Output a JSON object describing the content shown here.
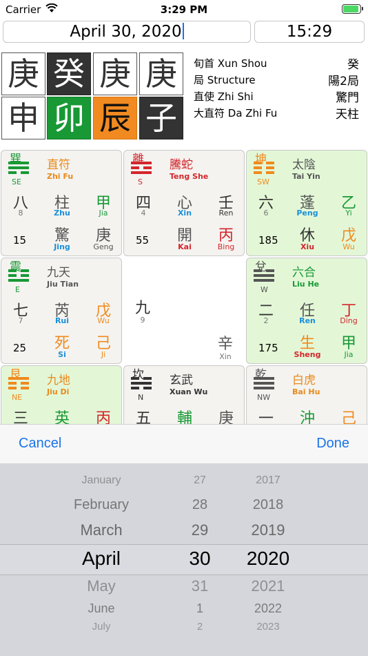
{
  "status": {
    "carrier": "Carrier",
    "time": "3:29 PM"
  },
  "date_field": {
    "value": "April 30, 2020"
  },
  "time_field": {
    "value": "15:29"
  },
  "ganzhi": {
    "row1": [
      "庚",
      "癸",
      "庚",
      "庚"
    ],
    "row2": [
      "申",
      "卯",
      "辰",
      "子"
    ]
  },
  "info": [
    {
      "label": "旬首 Xun Shou",
      "value": "癸"
    },
    {
      "label": "局 Structure",
      "value": "陽2局"
    },
    {
      "label": "直使 Zhi Shi",
      "value": "驚門"
    },
    {
      "label": "大直符 Da Zhi Fu",
      "value": "天柱"
    }
  ],
  "palaces": [
    {
      "gua": "巽",
      "dir": "SE",
      "god": "直符",
      "god_py": "Zhi Fu",
      "god_color": "#e88a1d",
      "tri_color": "#189935",
      "num_cn": "八",
      "num": "8",
      "star": "柱",
      "star_py": "Zhu",
      "stem1": "甲",
      "stem1_py": "Jia",
      "stem1_color": "#189935",
      "count": "15",
      "door": "驚",
      "door_py": "Jing",
      "stem2": "庚",
      "stem2_py": "Geng",
      "stem2_color": "#555555"
    },
    {
      "gua": "離",
      "dir": "S",
      "god": "騰蛇",
      "god_py": "Teng She",
      "god_color": "#d4262c",
      "tri_color": "#d4262c",
      "num_cn": "四",
      "num": "4",
      "star": "心",
      "star_py": "Xin",
      "stem1": "壬",
      "stem1_py": "Ren",
      "stem1_color": "#333333",
      "count": "55",
      "door": "開",
      "door_py": "Kai",
      "stem2": "丙",
      "stem2_py": "Bing",
      "stem2_color": "#d4262c"
    },
    {
      "gua": "坤",
      "dir": "SW",
      "god": "太陰",
      "god_py": "Tai Yin",
      "god_color": "#555555",
      "tri_color": "#f08a1d",
      "num_cn": "六",
      "num": "6",
      "star": "蓬",
      "star_py": "Peng",
      "stem1": "乙",
      "stem1_py": "Yi",
      "stem1_color": "#189935",
      "count": "185",
      "door": "休",
      "door_py": "Xiu",
      "stem2": "戊",
      "stem2_py": "Wu",
      "stem2_color": "#f08a1d"
    },
    {
      "gua": "震",
      "dir": "E",
      "god": "九天",
      "god_py": "Jiu Tian",
      "god_color": "#555555",
      "tri_color": "#189935",
      "num_cn": "七",
      "num": "7",
      "star": "芮",
      "star_py": "Rui",
      "stem1": "戊",
      "stem1_py": "Wu",
      "stem1_color": "#f08a1d",
      "count": "25",
      "door": "死",
      "door_py": "Si",
      "stem2": "己",
      "stem2_py": "Ji",
      "stem2_color": "#f08a1d"
    },
    {
      "center_num_cn": "九",
      "center_num": "9",
      "center_stem": "辛",
      "center_stem_py": "Xin"
    },
    {
      "gua": "兌",
      "dir": "W",
      "god": "六合",
      "god_py": "Liu He",
      "god_color": "#189935",
      "tri_color": "#555555",
      "num_cn": "二",
      "num": "2",
      "star": "任",
      "star_py": "Ren",
      "stem1": "丁",
      "stem1_py": "Ding",
      "stem1_color": "#d4262c",
      "count": "175",
      "door": "生",
      "door_py": "Sheng",
      "stem2": "甲",
      "stem2_py": "Jia",
      "stem2_color": "#189935"
    },
    {
      "gua": "艮",
      "dir": "NE",
      "god": "九地",
      "god_py": "Jiu Di",
      "god_color": "#e88a1d",
      "tri_color": "#f08a1d",
      "num_cn": "三",
      "star": "英",
      "stem1": "丙",
      "stem1_color": "#d4262c"
    },
    {
      "gua": "坎",
      "dir": "N",
      "god": "玄武",
      "god_py": "Xuan Wu",
      "god_color": "#333333",
      "tri_color": "#333333",
      "num_cn": "五",
      "star": "輔",
      "stem1": "庚",
      "stem1_color": "#555555"
    },
    {
      "gua": "乾",
      "dir": "NW",
      "god": "白虎",
      "god_py": "Bai Hu",
      "god_color": "#e88a1d",
      "tri_color": "#555555",
      "num_cn": "一",
      "star": "沖",
      "stem1": "己",
      "stem1_color": "#f08a1d"
    }
  ],
  "toolbar": {
    "cancel": "Cancel",
    "done": "Done"
  },
  "picker": {
    "months": [
      "January",
      "February",
      "March",
      "April",
      "May",
      "June",
      "July"
    ],
    "days": [
      "27",
      "28",
      "29",
      "30",
      "31",
      "1",
      "2"
    ],
    "years": [
      "2017",
      "2018",
      "2019",
      "2020",
      "2021",
      "2022",
      "2023"
    ],
    "selected_index": 3
  },
  "colors": {
    "accent": "#1a73e8",
    "green": "#189935",
    "orange": "#f08a1d",
    "red": "#d4262c"
  }
}
